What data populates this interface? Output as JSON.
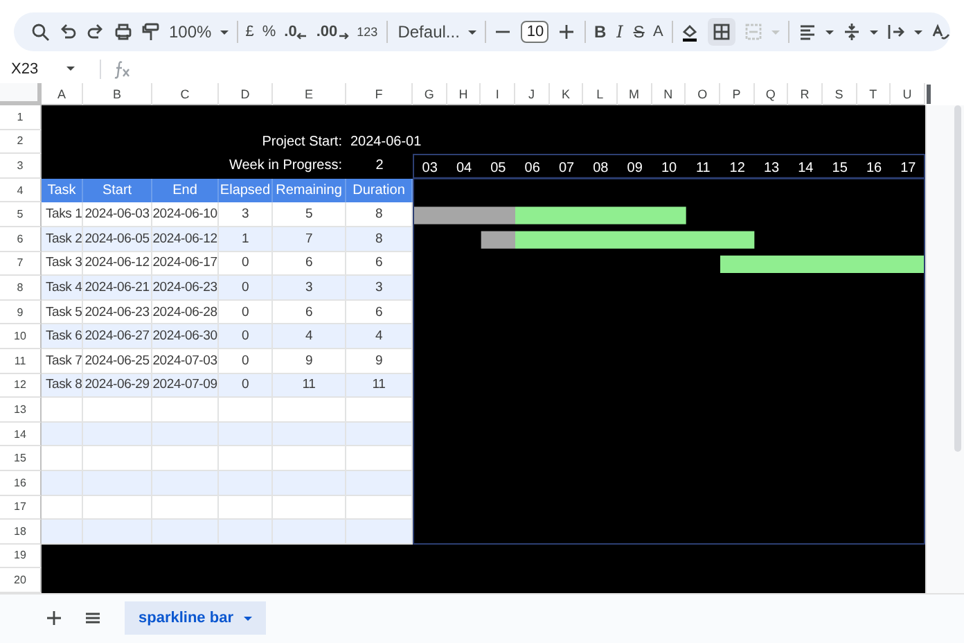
{
  "toolbar": {
    "zoom": "100%",
    "currency": "£",
    "percent": "%",
    "decrease_decimals": ".0",
    "increase_decimals": ".00",
    "number_format": "123",
    "font": "Defaul...",
    "font_size": "10",
    "bold": "B",
    "italic": "I",
    "strikethrough": "S",
    "text_color": "A"
  },
  "formula_bar": {
    "cell_reference": "X23"
  },
  "sheet": {
    "columns": [
      "A",
      "B",
      "C",
      "D",
      "E",
      "F",
      "G",
      "H",
      "I",
      "J",
      "K",
      "L",
      "M",
      "N",
      "O",
      "P",
      "Q",
      "R",
      "S",
      "T",
      "U"
    ],
    "rows": [
      "1",
      "2",
      "3",
      "4",
      "5",
      "6",
      "7",
      "8",
      "9",
      "10",
      "11",
      "12",
      "13",
      "14",
      "15",
      "16",
      "17",
      "18",
      "19",
      "20"
    ],
    "project_start_label": "Project Start:",
    "project_start": "2024-06-01",
    "week_label": "Week in Progress:",
    "week": "2",
    "table": {
      "columns": [
        "Task",
        "Start",
        "End",
        "Elapsed",
        "Remaining",
        "Duration"
      ],
      "rows": [
        [
          "Taks 1",
          "2024-06-03",
          "2024-06-10",
          "3",
          "5",
          "8"
        ],
        [
          "Task 2",
          "2024-06-05",
          "2024-06-12",
          "1",
          "7",
          "8"
        ],
        [
          "Task 3",
          "2024-06-12",
          "2024-06-17",
          "0",
          "6",
          "6"
        ],
        [
          "Task 4",
          "2024-06-21",
          "2024-06-23",
          "0",
          "3",
          "3"
        ],
        [
          "Task 5",
          "2024-06-23",
          "2024-06-28",
          "0",
          "6",
          "6"
        ],
        [
          "Task 6",
          "2024-06-27",
          "2024-06-30",
          "0",
          "4",
          "4"
        ],
        [
          "Task 7",
          "2024-06-25",
          "2024-07-03",
          "0",
          "9",
          "9"
        ],
        [
          "Task 8",
          "2024-06-29",
          "2024-07-09",
          "0",
          "11",
          "11"
        ]
      ]
    },
    "gantt": {
      "day_labels": [
        "03",
        "04",
        "05",
        "06",
        "07",
        "08",
        "09",
        "10",
        "11",
        "12",
        "13",
        "14",
        "15",
        "16",
        "17"
      ]
    }
  },
  "sheet_tabs": [
    {
      "label": "sparkline bar",
      "selected": true
    }
  ]
}
